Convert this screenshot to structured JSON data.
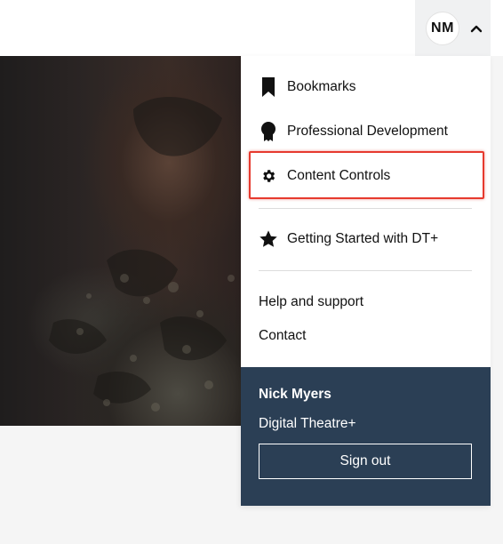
{
  "header": {
    "avatar_initials": "NM",
    "toggle_icon": "chevron-up-icon"
  },
  "menu": {
    "items": [
      {
        "label": "Bookmarks",
        "icon": "bookmark-icon"
      },
      {
        "label": "Professional Development",
        "icon": "award-ribbon-icon"
      },
      {
        "label": "Content Controls",
        "icon": "gear-icon",
        "highlighted": true
      },
      {
        "label": "Getting Started with DT+",
        "icon": "star-icon"
      }
    ],
    "links": [
      {
        "label": "Help and support"
      },
      {
        "label": "Contact"
      }
    ]
  },
  "account": {
    "name": "Nick Myers",
    "organization": "Digital Theatre+",
    "signout_label": "Sign out"
  },
  "colors": {
    "account_bg": "#2b3f55",
    "highlight": "#e63a2e",
    "topbar_toggle_bg": "#f0f1f2"
  }
}
